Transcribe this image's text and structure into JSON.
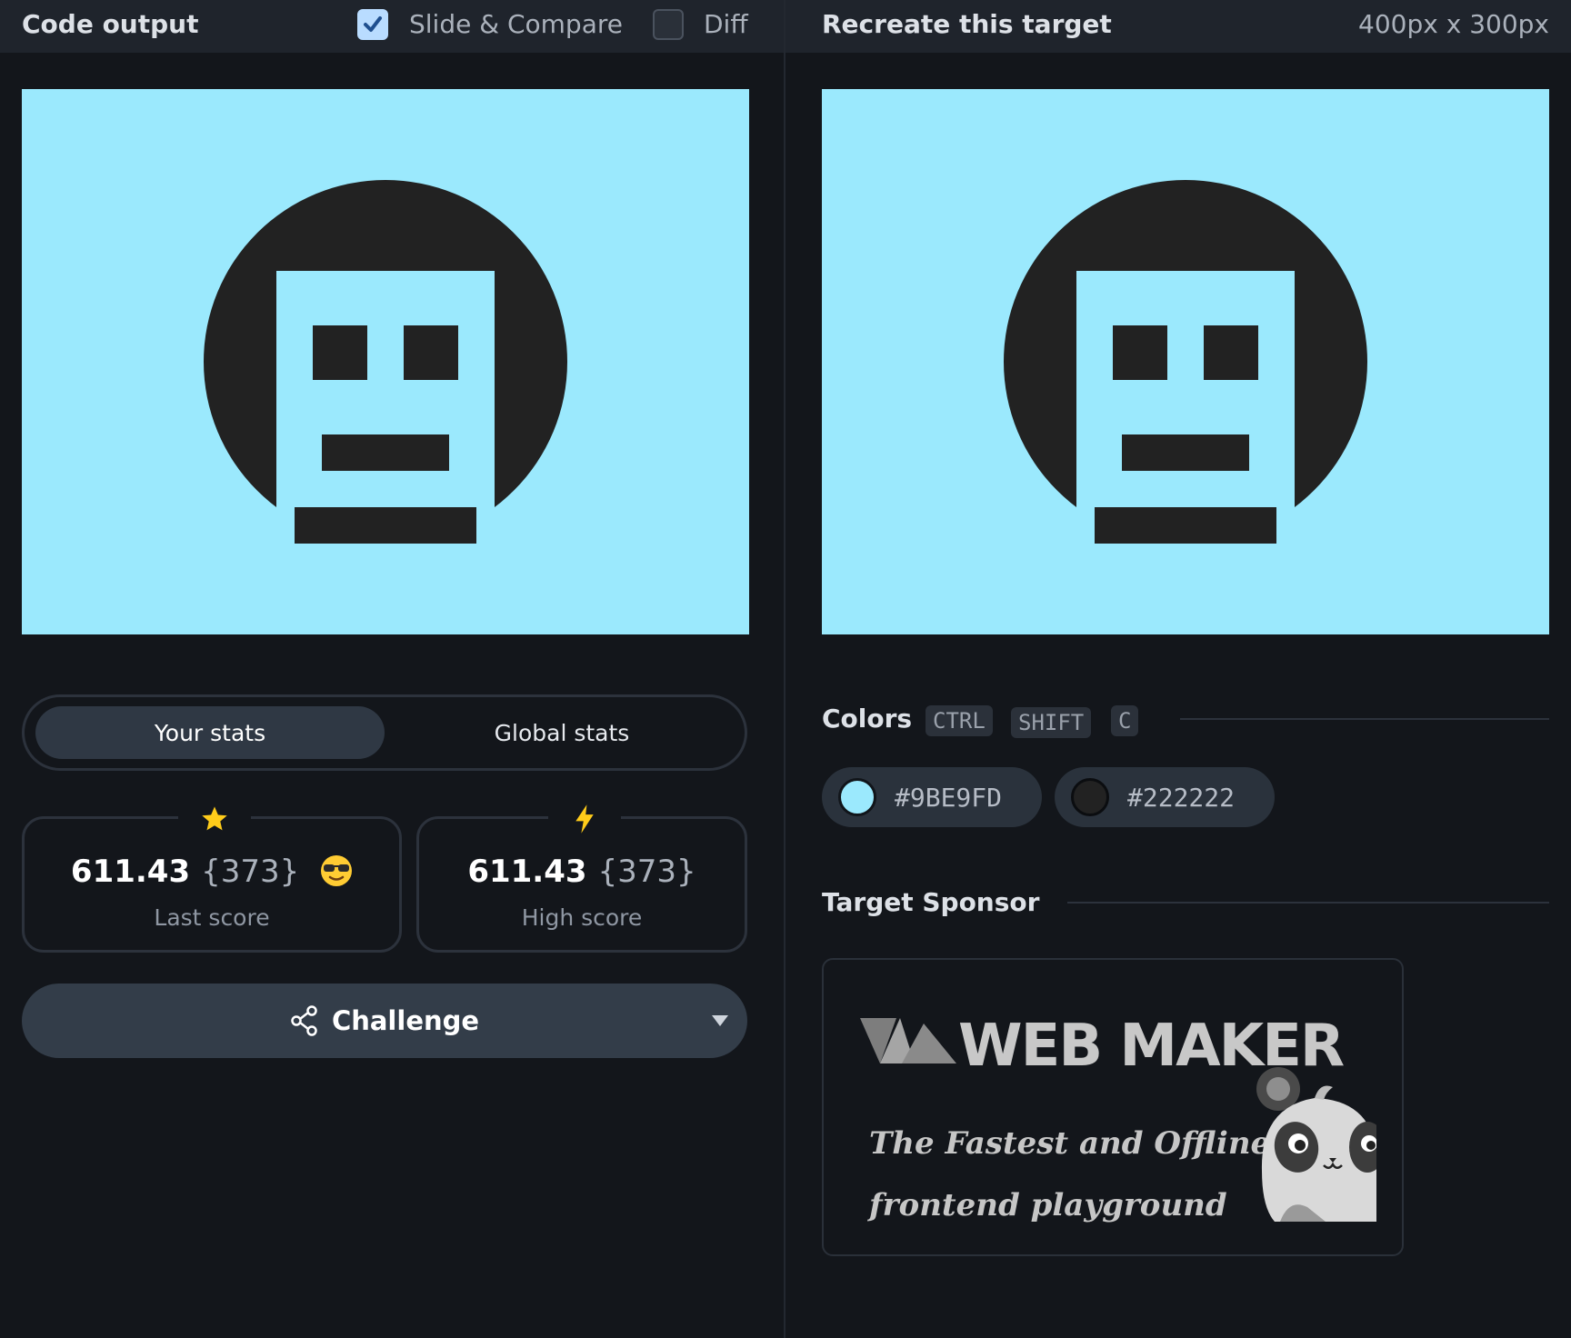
{
  "left_panel": {
    "title": "Code output",
    "slide_compare": {
      "label": "Slide & Compare",
      "checked": true
    },
    "diff": {
      "label": "Diff",
      "checked": false
    }
  },
  "right_panel": {
    "title": "Recreate this target",
    "dimensions": "400px x 300px"
  },
  "target": {
    "background": "#9BE9FD",
    "foreground": "#222222"
  },
  "stats_toggle": {
    "your_stats": "Your stats",
    "global_stats": "Global stats",
    "active": "your_stats"
  },
  "last_score": {
    "value": "611.43",
    "count": "{373}",
    "label": "Last score",
    "icon": "star-icon",
    "emoji": "sunglasses-emoji"
  },
  "high_score": {
    "value": "611.43",
    "count": "{373}",
    "label": "High score",
    "icon": "lightning-icon"
  },
  "challenge": {
    "label": "Challenge",
    "icon": "share-icon"
  },
  "colors": {
    "title": "Colors",
    "shortcut": [
      "CTRL",
      "SHIFT",
      "C"
    ],
    "swatches": [
      "#9BE9FD",
      "#222222"
    ]
  },
  "sponsor": {
    "title": "Target Sponsor",
    "name": "WEB MAKER",
    "tagline_1": "The Fastest and Offline",
    "tagline_2": "frontend playground"
  }
}
